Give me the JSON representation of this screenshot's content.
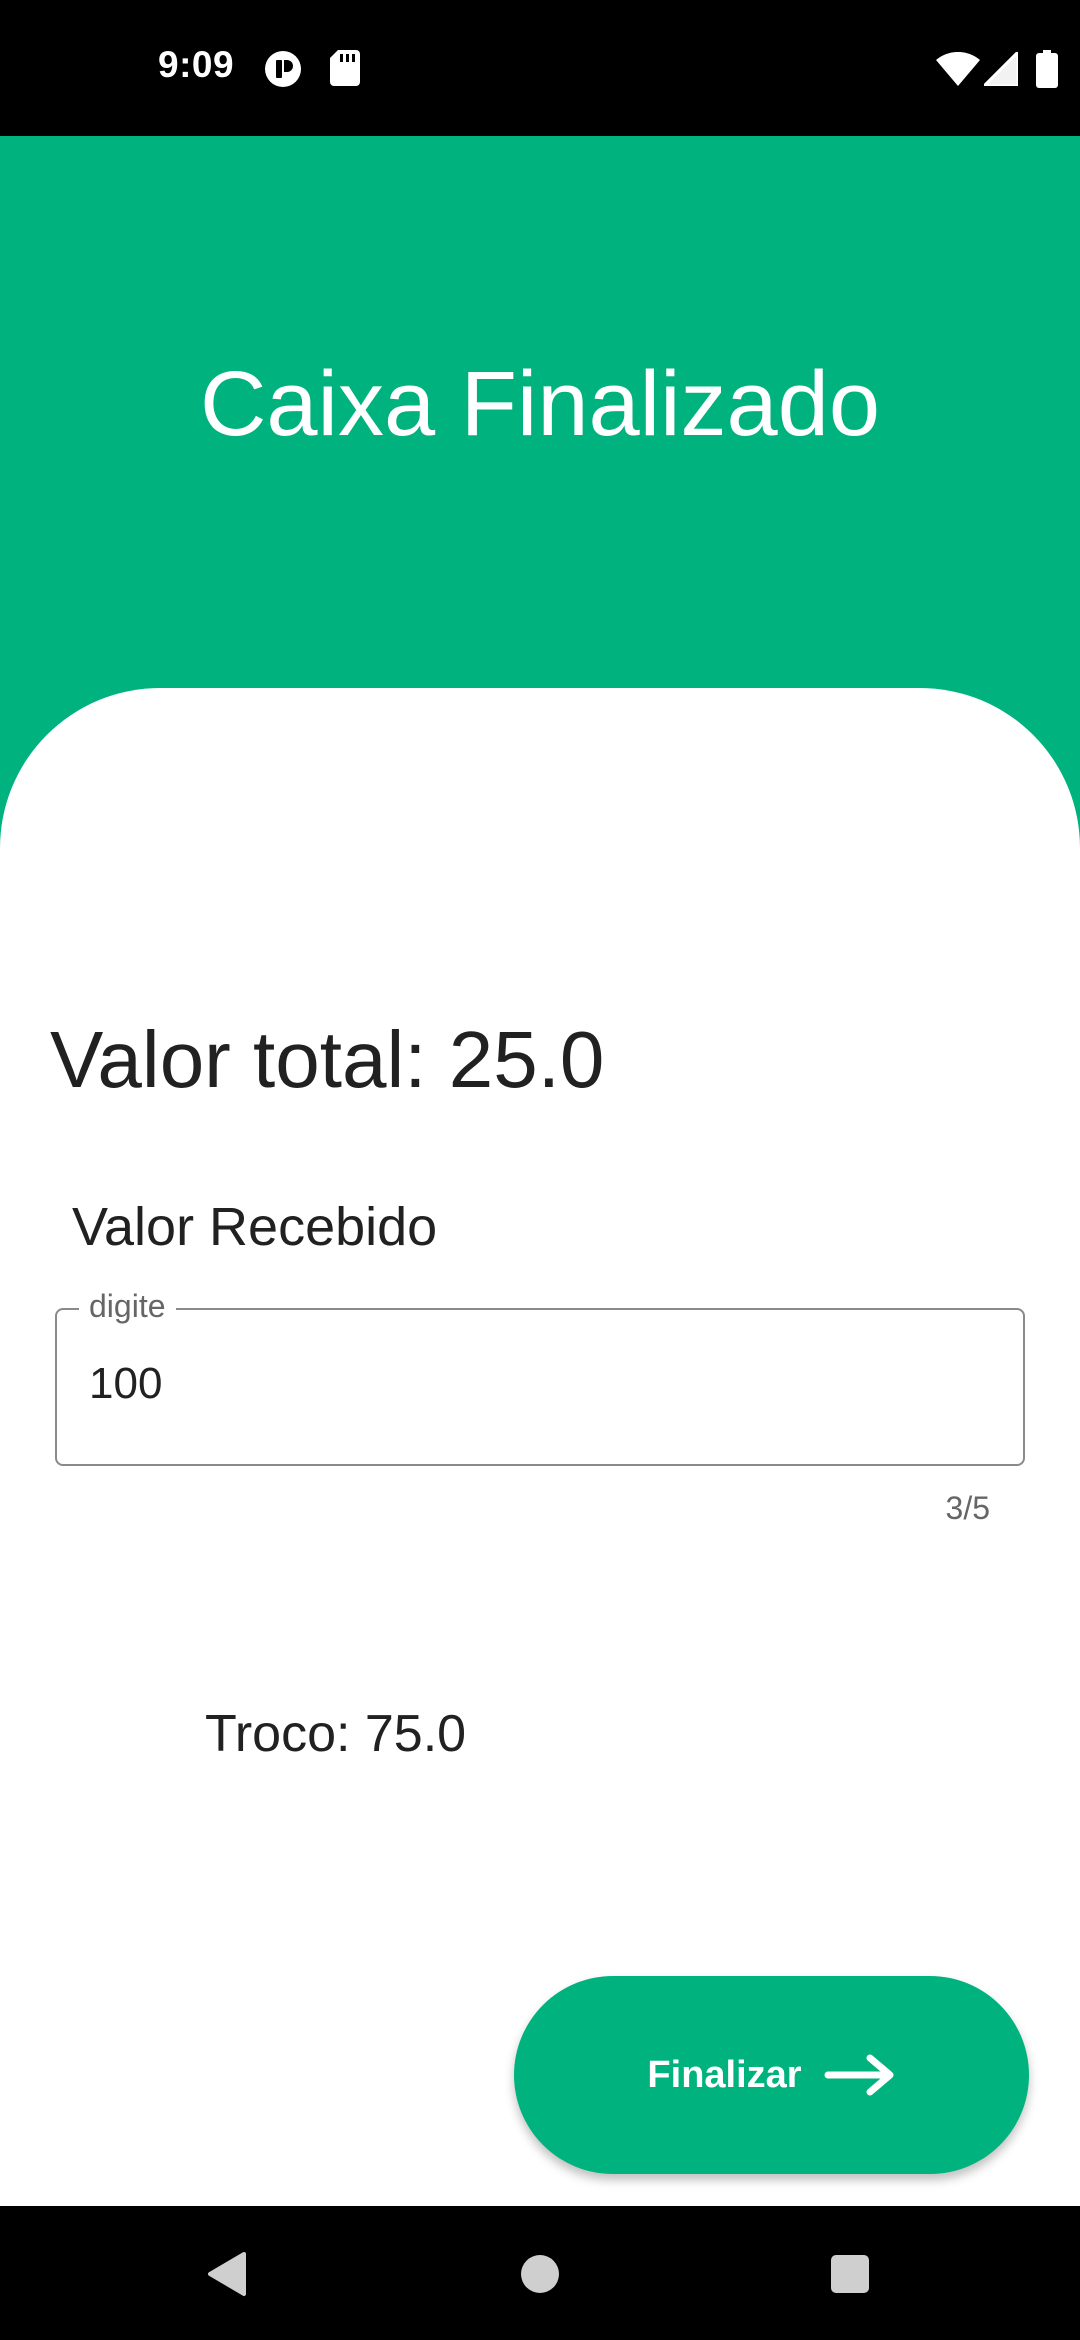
{
  "status_bar": {
    "time": "9:09",
    "icons": [
      "notification-icon",
      "sd-card-icon",
      "wifi-icon",
      "signal-icon",
      "battery-icon"
    ]
  },
  "header": {
    "title": "Caixa Finalizado"
  },
  "main": {
    "total_label": "Valor total: 25.0",
    "received_label": "Valor Recebido",
    "received_field": {
      "legend": "digite",
      "value": "100",
      "counter": "3/5"
    },
    "change_label": "Troco: 75.0"
  },
  "actions": {
    "finalize_label": "Finalizar",
    "finalize_icon": "arrow-right-icon"
  },
  "nav_bar": {
    "icons": [
      "back-icon",
      "home-icon",
      "recents-icon"
    ]
  },
  "colors": {
    "accent": "#00b37e",
    "text": "#212121",
    "muted": "#666666",
    "system_bars": "#000000"
  }
}
